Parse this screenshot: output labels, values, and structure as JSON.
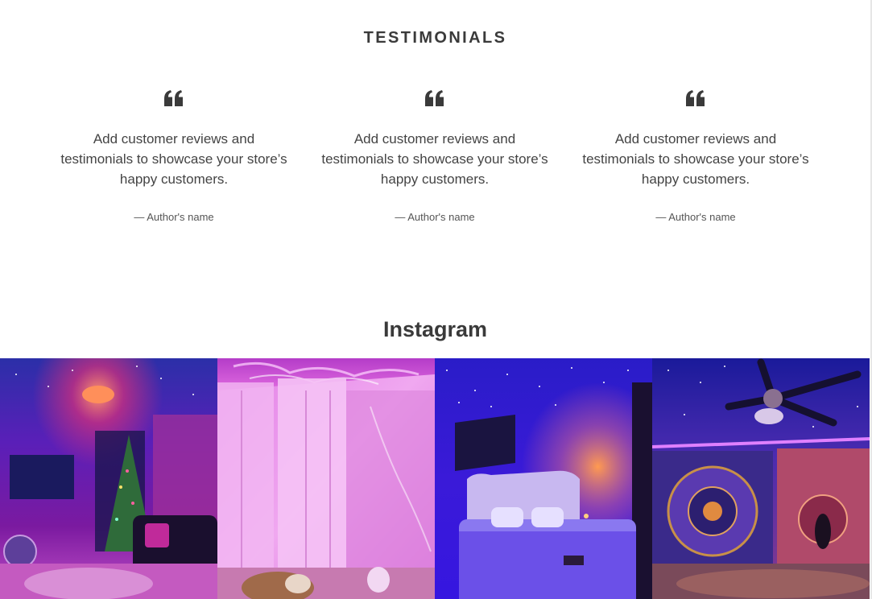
{
  "testimonials": {
    "title": "TESTIMONIALS",
    "items": [
      {
        "text": "Add customer reviews and testimonials to showcase your store’s happy customers.",
        "author": "— Author's name"
      },
      {
        "text": "Add customer reviews and testimonials to showcase your store’s happy customers.",
        "author": "— Author's name"
      },
      {
        "text": "Add customer reviews and testimonials to showcase your store’s happy customers.",
        "author": "— Author's name"
      }
    ]
  },
  "instagram": {
    "title": "Instagram",
    "posts": [
      {
        "subject": "living room with christmas tree under galaxy projector light"
      },
      {
        "subject": "bedroom curtains with pink aurora projection and sleeping bulldog"
      },
      {
        "subject": "bed with tufted headboard under blue starry ceiling"
      },
      {
        "subject": "tapestry bedroom with ceiling fan and LED strip"
      }
    ]
  },
  "colors": {
    "text": "#3a3a3a",
    "background": "#ffffff"
  }
}
